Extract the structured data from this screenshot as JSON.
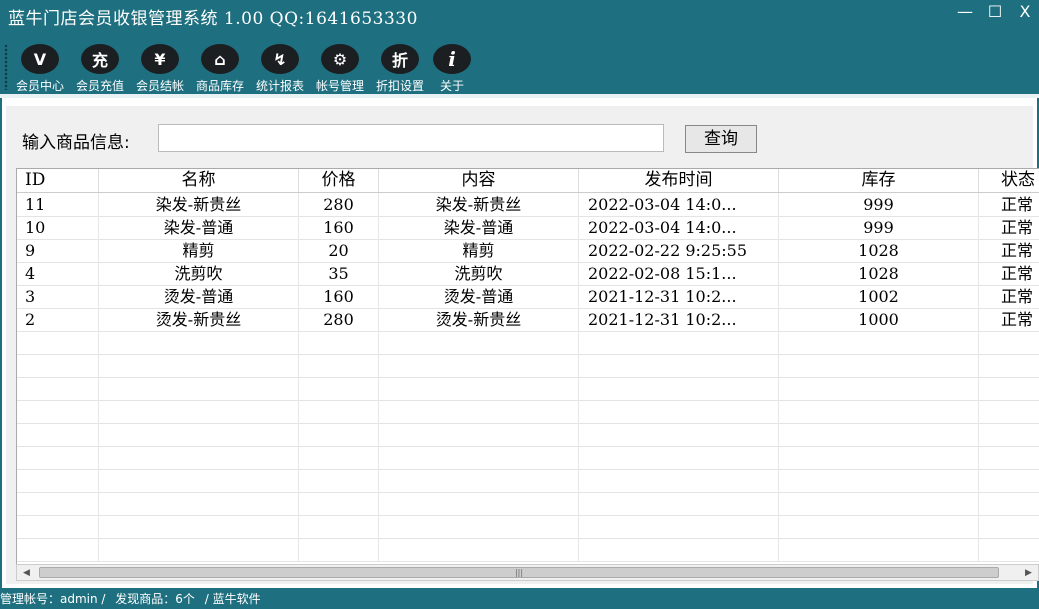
{
  "window": {
    "title": "蓝牛门店会员收银管理系统 1.00    QQ:1641653330",
    "minimize": "—",
    "maximize": "☐",
    "close": "X"
  },
  "toolbar": {
    "items": [
      {
        "label": "会员中心",
        "icon": "vip-icon",
        "glyph": "V"
      },
      {
        "label": "会员充值",
        "icon": "recharge-icon",
        "glyph": "充"
      },
      {
        "label": "会员结帐",
        "icon": "yen-icon",
        "glyph": "¥"
      },
      {
        "label": "商品库存",
        "icon": "warehouse-icon",
        "glyph": "⌂"
      },
      {
        "label": "统计报表",
        "icon": "report-icon",
        "glyph": "↯"
      },
      {
        "label": "帐号管理",
        "icon": "account-icon",
        "glyph": "⚙"
      },
      {
        "label": "折扣设置",
        "icon": "discount-icon",
        "glyph": "折"
      },
      {
        "label": "关于",
        "icon": "info-icon",
        "glyph": "i"
      }
    ]
  },
  "search": {
    "label": "输入商品信息:",
    "value": "",
    "button": "查询"
  },
  "table": {
    "columns": [
      "ID",
      "名称",
      "价格",
      "内容",
      "发布时间",
      "库存",
      "状态"
    ],
    "rows": [
      [
        "11",
        "染发-新贵丝",
        "280",
        "染发-新贵丝",
        "2022-03-04 14:0...",
        "999",
        "正常"
      ],
      [
        "10",
        "染发-普通",
        "160",
        "染发-普通",
        "2022-03-04 14:0...",
        "999",
        "正常"
      ],
      [
        "9",
        "精剪",
        "20",
        "精剪",
        "2022-02-22 9:25:55",
        "1028",
        "正常"
      ],
      [
        "4",
        "洗剪吹",
        "35",
        "洗剪吹",
        "2022-02-08 15:1...",
        "1028",
        "正常"
      ],
      [
        "3",
        "烫发-普通",
        "160",
        "烫发-普通",
        "2021-12-31 10:2...",
        "1002",
        "正常"
      ],
      [
        "2",
        "烫发-新贵丝",
        "280",
        "烫发-新贵丝",
        "2021-12-31 10:2...",
        "1000",
        "正常"
      ]
    ]
  },
  "status": {
    "account": "管理帐号：admin /",
    "found": "发现商品：6个",
    "vendor": "/ 蓝牛软件"
  }
}
